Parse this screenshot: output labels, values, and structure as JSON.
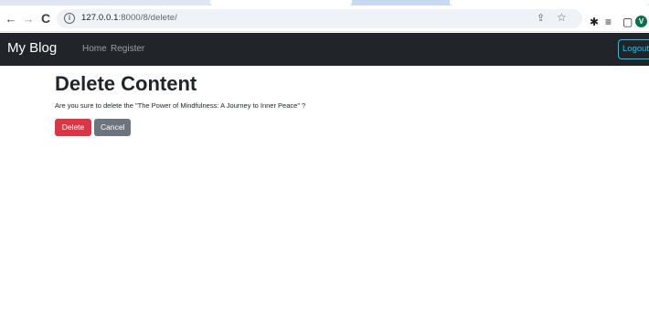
{
  "browser": {
    "url_host": "127.0.0.1",
    "url_rest": ":8000/8/delete/",
    "back_icon": "←",
    "forward_icon": "→",
    "reload_icon": "C",
    "info_icon": "i",
    "share_icon": "⇪",
    "star_icon": "☆",
    "extensions_icon": "✱",
    "queue_icon": "≡",
    "sidepanel_icon": "▢",
    "avatar_letter": "V",
    "menu_icon": "⋮"
  },
  "navbar": {
    "brand": "My Blog",
    "links": [
      "Home",
      "Register"
    ],
    "logout": "Logout"
  },
  "main": {
    "title": "Delete Content",
    "confirm_text": "Are you sure to delete the \"The Power of Mindfulness: A Journey to Inner Peace\" ?",
    "delete_label": "Delete",
    "cancel_label": "Cancel"
  },
  "colors": {
    "navbar_bg": "#212529",
    "danger": "#dc3545",
    "secondary": "#6c757d",
    "logout_accent": "#0dcaf0",
    "avatar_bg": "#0d6e4e"
  }
}
